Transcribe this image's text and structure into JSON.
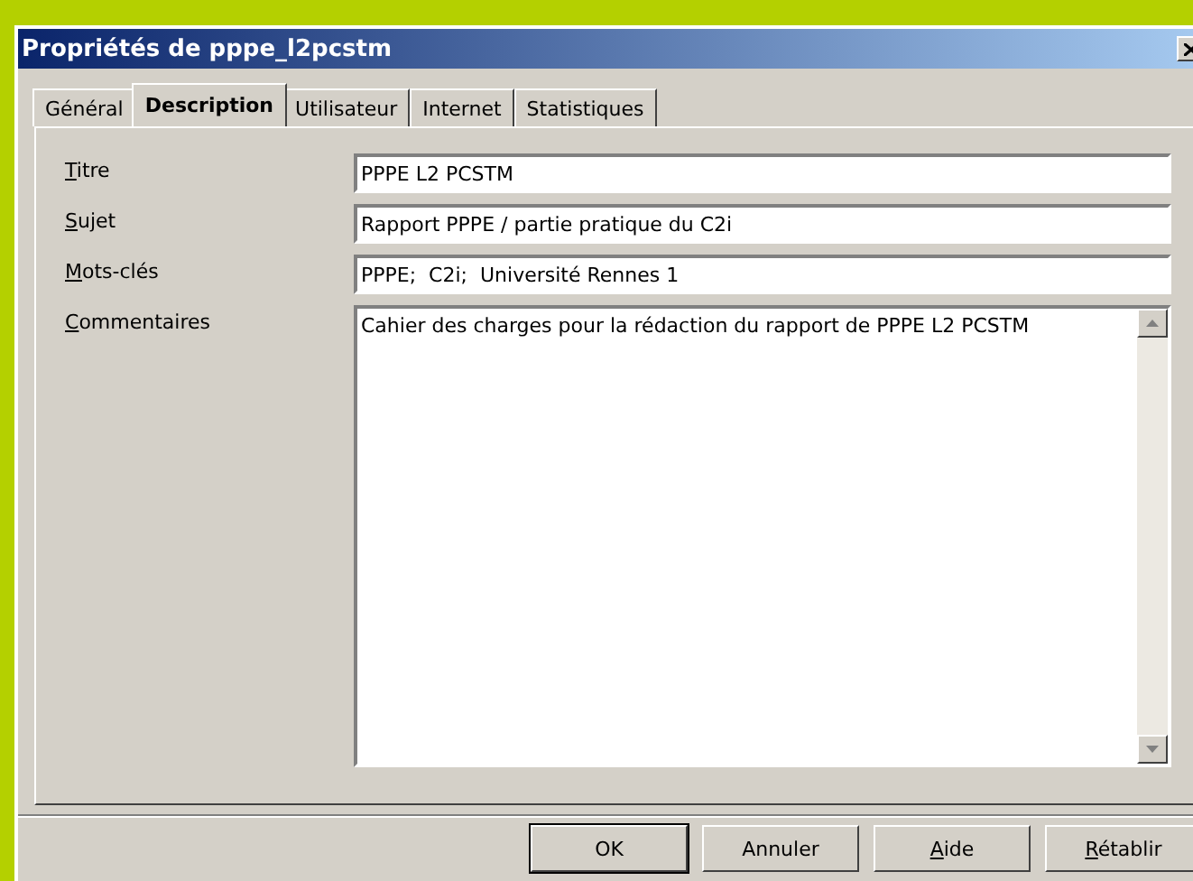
{
  "window": {
    "title": "Propriétés de pppe_l2pcstm"
  },
  "tabs": [
    {
      "label": "Général",
      "selected": false
    },
    {
      "label": "Description",
      "selected": true
    },
    {
      "label": "Utilisateur",
      "selected": false
    },
    {
      "label": "Internet",
      "selected": false
    },
    {
      "label": "Statistiques",
      "selected": false
    }
  ],
  "fields": [
    {
      "label": "Titre",
      "underline_first": true,
      "value": "PPPE L2 PCSTM",
      "kind": "line"
    },
    {
      "label": "Sujet",
      "underline_first": true,
      "value": "Rapport PPPE / partie pratique du C2i",
      "kind": "line"
    },
    {
      "label": "Mots-clés",
      "underline_first": true,
      "value": "PPPE;  C2i;  Université Rennes 1",
      "kind": "line"
    },
    {
      "label": "Commentaires",
      "underline_first": true,
      "value": "Cahier des charges pour la rédaction du rapport de PPPE L2 PCSTM",
      "kind": "area"
    }
  ],
  "buttons": [
    {
      "label": "OK",
      "default": true,
      "underline_first": false
    },
    {
      "label": "Annuler",
      "default": false,
      "underline_first": false
    },
    {
      "label": "Aide",
      "underline_first": true,
      "default": false
    },
    {
      "label": "Rétablir",
      "underline_first": true,
      "default": false
    }
  ]
}
